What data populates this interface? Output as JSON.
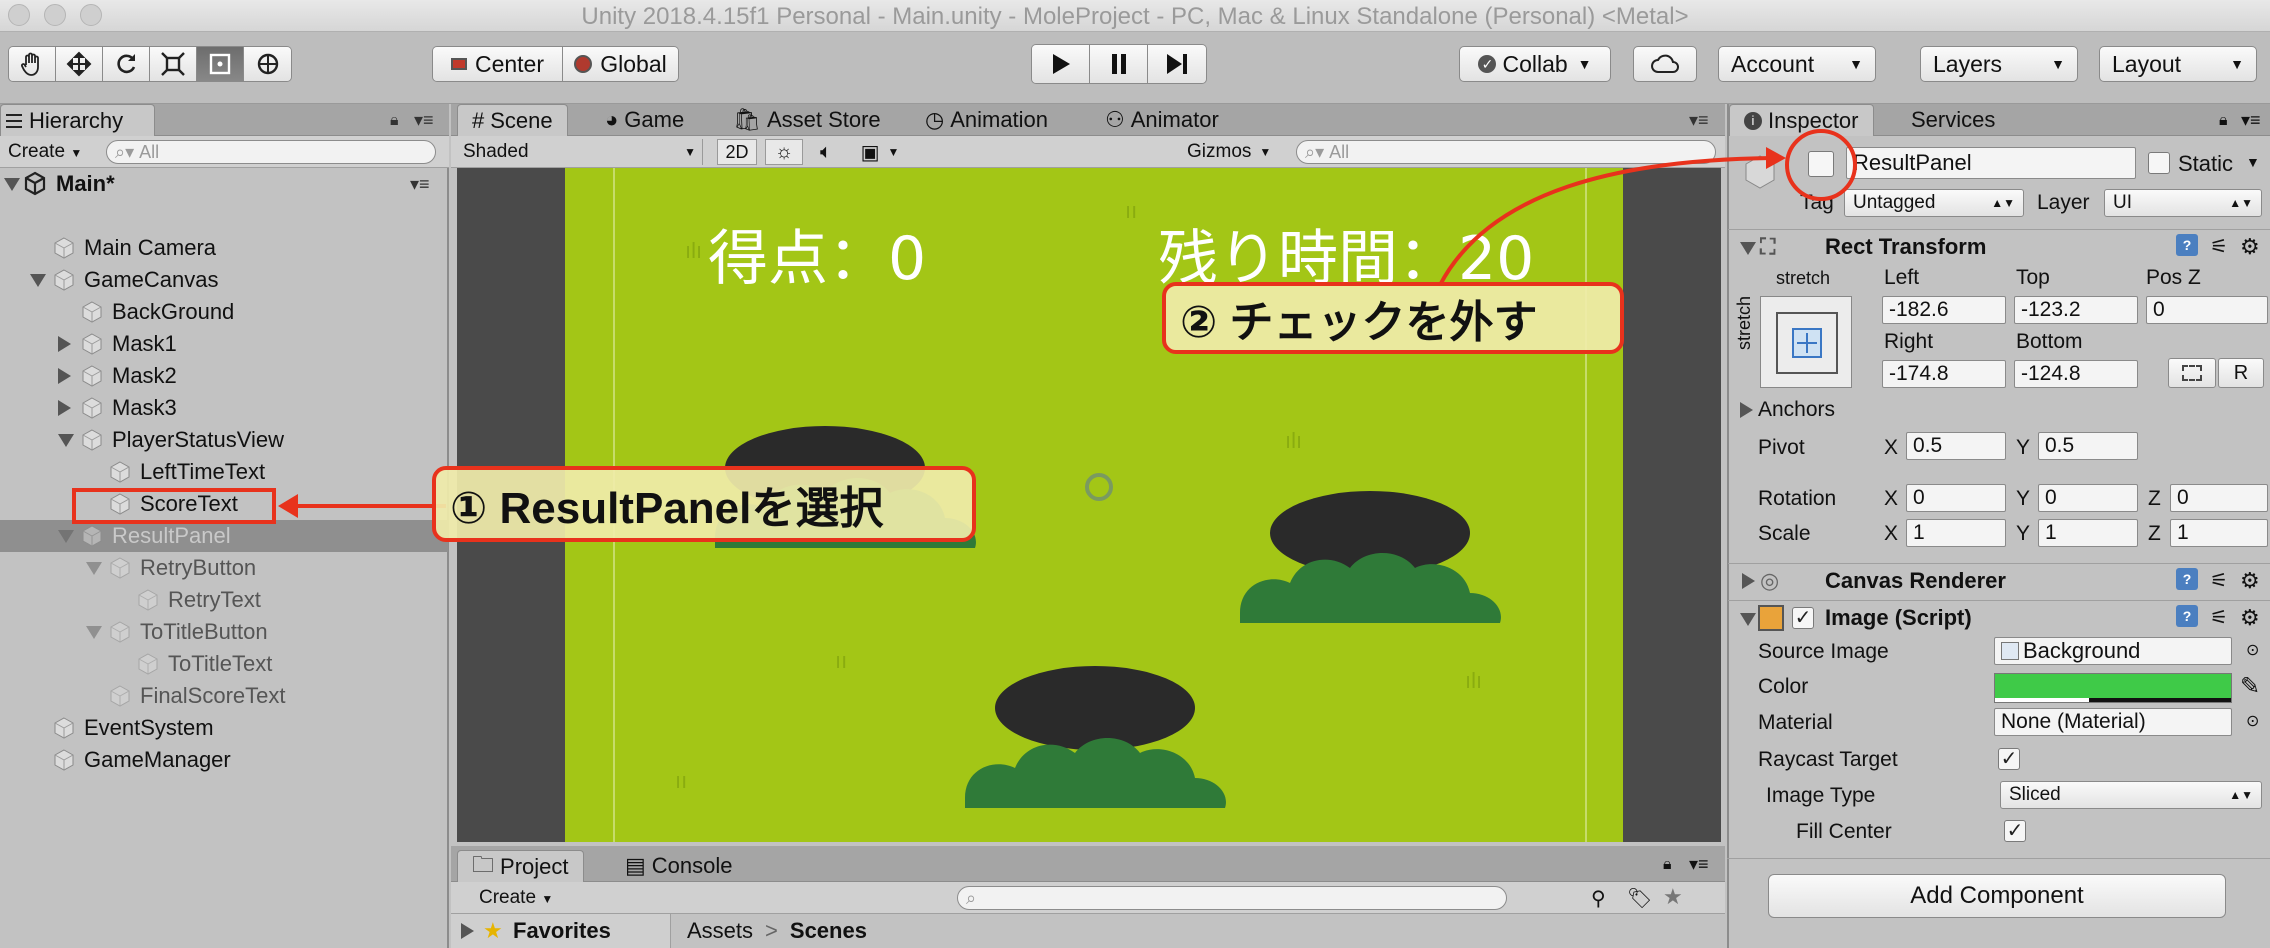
{
  "window": {
    "title": "Unity 2018.4.15f1 Personal - Main.unity - MoleProject - PC, Mac & Linux Standalone (Personal) <Metal>"
  },
  "toolbar": {
    "pivot_label": "Center",
    "space_label": "Global",
    "collab_label": "Collab",
    "account_label": "Account",
    "layers_label": "Layers",
    "layout_label": "Layout"
  },
  "hierarchy": {
    "tab": "Hierarchy",
    "create": "Create",
    "search_placeholder": "All",
    "scene": "Main*",
    "items": [
      {
        "label": "Main Camera"
      },
      {
        "label": "GameCanvas"
      },
      {
        "label": "BackGround"
      },
      {
        "label": "Mask1"
      },
      {
        "label": "Mask2"
      },
      {
        "label": "Mask3"
      },
      {
        "label": "PlayerStatusView"
      },
      {
        "label": "LeftTimeText"
      },
      {
        "label": "ScoreText"
      },
      {
        "label": "ResultPanel"
      },
      {
        "label": "RetryButton"
      },
      {
        "label": "RetryText"
      },
      {
        "label": "ToTitleButton"
      },
      {
        "label": "ToTitleText"
      },
      {
        "label": "FinalScoreText"
      },
      {
        "label": "EventSystem"
      },
      {
        "label": "GameManager"
      }
    ]
  },
  "scene_panel": {
    "tabs": [
      {
        "label": "Scene"
      },
      {
        "label": "Game"
      },
      {
        "label": "Asset Store"
      },
      {
        "label": "Animation"
      },
      {
        "label": "Animator"
      }
    ],
    "shading": "Shaded",
    "mode_2d": "2D",
    "gizmos": "Gizmos",
    "search_placeholder": "All",
    "score_text": "得点：0",
    "time_text": "残り時間：20"
  },
  "annotations": {
    "step1": "① ResultPanelを選択",
    "step2": "② チェックを外す",
    "accent": "#e8321c"
  },
  "project_panel": {
    "tabs": [
      {
        "label": "Project"
      },
      {
        "label": "Console"
      }
    ],
    "create": "Create",
    "favorites": "Favorites",
    "crumb_root": "Assets",
    "crumb_sep": ">",
    "crumb_leaf": "Scenes"
  },
  "inspector": {
    "tabs": [
      {
        "label": "Inspector"
      },
      {
        "label": "Services"
      }
    ],
    "object_name": "ResultPanel",
    "static_label": "Static",
    "tag_label": "Tag",
    "tag_value": "Untagged",
    "layer_label": "Layer",
    "layer_value": "UI",
    "rect_transform": {
      "title": "Rect Transform",
      "anchor_h": "stretch",
      "anchor_v": "stretch",
      "left_label": "Left",
      "left": "-182.6",
      "top_label": "Top",
      "top": "-123.2",
      "posz_label": "Pos Z",
      "posz": "0",
      "right_label": "Right",
      "right": "-174.8",
      "bottom_label": "Bottom",
      "bottom": "-124.8",
      "r_button": "R",
      "anchors_label": "Anchors",
      "pivot_label": "Pivot",
      "pivot_x": "0.5",
      "pivot_y": "0.5",
      "rotation_label": "Rotation",
      "rot_x": "0",
      "rot_y": "0",
      "rot_z": "0",
      "scale_label": "Scale",
      "scale_x": "1",
      "scale_y": "1",
      "scale_z": "1",
      "x": "X",
      "y": "Y",
      "z": "Z"
    },
    "canvas_renderer": {
      "title": "Canvas Renderer"
    },
    "image": {
      "title": "Image (Script)",
      "source_label": "Source Image",
      "source_value": "Background",
      "color_label": "Color",
      "color_value": "#3fca48",
      "material_label": "Material",
      "material_value": "None (Material)",
      "raycast_label": "Raycast Target",
      "image_type_label": "Image Type",
      "image_type_value": "Sliced",
      "fill_center_label": "Fill Center"
    },
    "add_component": "Add Component"
  }
}
